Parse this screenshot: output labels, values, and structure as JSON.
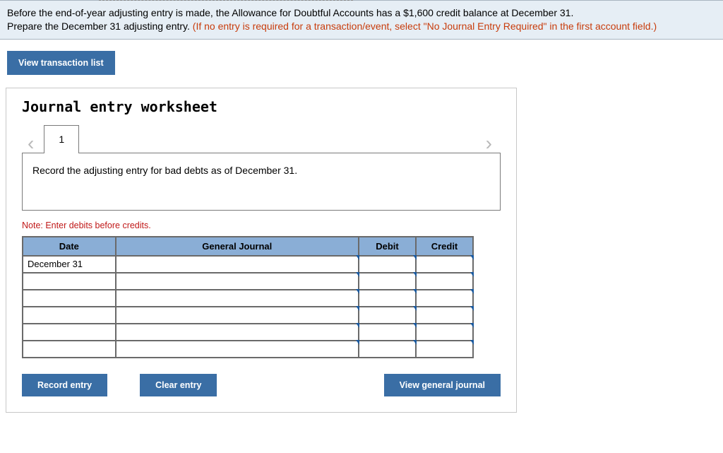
{
  "instruction": {
    "line1": "Before the end-of-year adjusting entry is made, the Allowance for Doubtful Accounts has a $1,600 credit balance at December 31.",
    "line2a": "Prepare the December 31 adjusting entry. ",
    "line2b": "(If no entry is required for a transaction/event, select \"No Journal Entry Required\" in the first account field.)"
  },
  "buttons": {
    "view_list": "View transaction list",
    "record": "Record entry",
    "clear": "Clear entry",
    "view_journal": "View general journal"
  },
  "worksheet": {
    "title": "Journal entry worksheet",
    "tab": "1",
    "prompt": "Record the adjusting entry for bad debts as of December 31.",
    "note": "Note: Enter debits before credits.",
    "headers": {
      "date": "Date",
      "gj": "General Journal",
      "debit": "Debit",
      "credit": "Credit"
    },
    "rows": [
      {
        "date": "December 31",
        "gj": "",
        "debit": "",
        "credit": ""
      },
      {
        "date": "",
        "gj": "",
        "debit": "",
        "credit": ""
      },
      {
        "date": "",
        "gj": "",
        "debit": "",
        "credit": ""
      },
      {
        "date": "",
        "gj": "",
        "debit": "",
        "credit": ""
      },
      {
        "date": "",
        "gj": "",
        "debit": "",
        "credit": ""
      },
      {
        "date": "",
        "gj": "",
        "debit": "",
        "credit": ""
      }
    ]
  }
}
